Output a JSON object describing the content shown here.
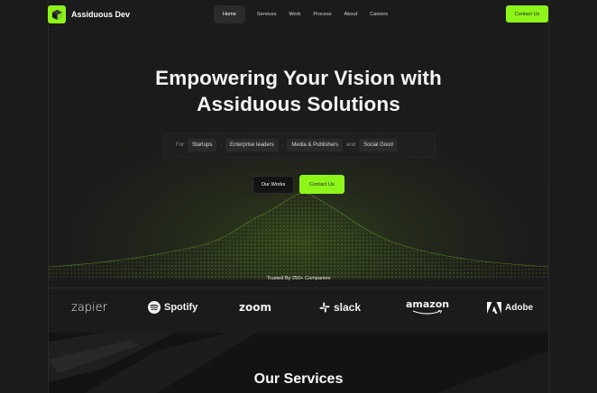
{
  "brand": {
    "name": "Assiduous Dev",
    "accent": "#8ef51a"
  },
  "nav": {
    "items": [
      "Home",
      "Services",
      "Work",
      "Process",
      "About",
      "Careers"
    ],
    "active": "Home",
    "cta": "Contact Us"
  },
  "hero": {
    "headline_line1": "Empowering Your Vision with",
    "headline_line2": "Assiduous Solutions",
    "for_label": "For",
    "chips": [
      "Startups",
      "Enterprise leaders",
      "Media & Publishers",
      "Social Good"
    ],
    "sep1": ",",
    "sep2": ",",
    "and_label": "and",
    "btn_works": "Our Works",
    "btn_contact": "Contact Us",
    "trusted": "Trusted By 250+ Companies"
  },
  "logos": [
    "zapier",
    "Spotify",
    "zoom",
    "slack",
    "amazon",
    "Adobe"
  ],
  "services": {
    "title": "Our Services"
  }
}
